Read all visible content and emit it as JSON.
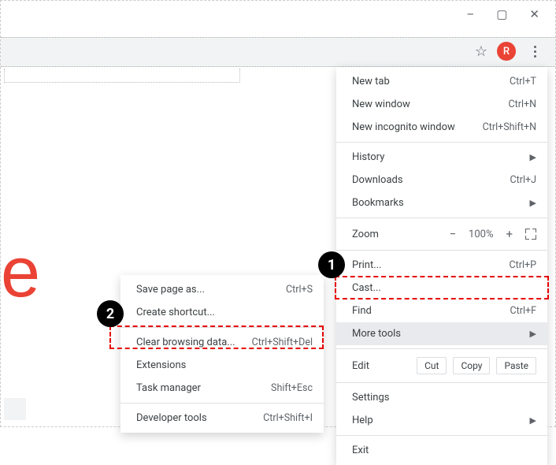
{
  "window_controls": {
    "minimize": "–",
    "maximize": "▢",
    "close": "✕"
  },
  "toolbar": {
    "avatar_letter": "R"
  },
  "badges": {
    "one": "1",
    "two": "2"
  },
  "main_menu": {
    "new_tab": {
      "label": "New tab",
      "shortcut": "Ctrl+T"
    },
    "new_window": {
      "label": "New window",
      "shortcut": "Ctrl+N"
    },
    "new_incognito": {
      "label": "New incognito window",
      "shortcut": "Ctrl+Shift+N"
    },
    "history": {
      "label": "History"
    },
    "downloads": {
      "label": "Downloads",
      "shortcut": "Ctrl+J"
    },
    "bookmarks": {
      "label": "Bookmarks"
    },
    "zoom": {
      "label": "Zoom",
      "minus": "−",
      "value": "100%",
      "plus": "+"
    },
    "print": {
      "label": "Print...",
      "shortcut": "Ctrl+P"
    },
    "cast": {
      "label": "Cast..."
    },
    "find": {
      "label": "Find",
      "shortcut": "Ctrl+F"
    },
    "more_tools": {
      "label": "More tools"
    },
    "edit": {
      "label": "Edit",
      "cut": "Cut",
      "copy": "Copy",
      "paste": "Paste"
    },
    "settings": {
      "label": "Settings"
    },
    "help": {
      "label": "Help"
    },
    "exit": {
      "label": "Exit"
    }
  },
  "sub_menu": {
    "save_page": {
      "label": "Save page as...",
      "shortcut": "Ctrl+S"
    },
    "create_shortcut": {
      "label": "Create shortcut..."
    },
    "clear_browsing": {
      "label": "Clear browsing data...",
      "shortcut": "Ctrl+Shift+Del"
    },
    "extensions": {
      "label": "Extensions"
    },
    "task_manager": {
      "label": "Task manager",
      "shortcut": "Shift+Esc"
    },
    "developer_tools": {
      "label": "Developer tools",
      "shortcut": "Ctrl+Shift+I"
    }
  },
  "bg_letter": "e"
}
